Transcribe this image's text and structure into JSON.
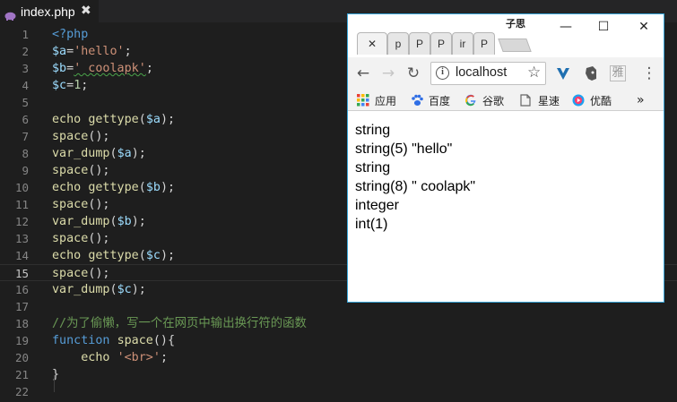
{
  "editor": {
    "tab": {
      "filename": "index.php",
      "close": "✖"
    },
    "lines": [
      {
        "n": "1",
        "tokens": [
          {
            "t": "<?php",
            "c": "kw"
          }
        ]
      },
      {
        "n": "2",
        "tokens": [
          {
            "t": "$a",
            "c": "var"
          },
          {
            "t": "=",
            "c": ""
          },
          {
            "t": "'hello'",
            "c": "str"
          },
          {
            "t": ";",
            "c": ""
          }
        ]
      },
      {
        "n": "3",
        "tokens": [
          {
            "t": "$b",
            "c": "var"
          },
          {
            "t": "=",
            "c": ""
          },
          {
            "t": "' coolapk'",
            "c": "str squig"
          },
          {
            "t": ";",
            "c": ""
          }
        ]
      },
      {
        "n": "4",
        "tokens": [
          {
            "t": "$c",
            "c": "var"
          },
          {
            "t": "=",
            "c": ""
          },
          {
            "t": "1",
            "c": "num"
          },
          {
            "t": ";",
            "c": ""
          }
        ]
      },
      {
        "n": "5",
        "tokens": []
      },
      {
        "n": "6",
        "tokens": [
          {
            "t": "echo ",
            "c": "fn"
          },
          {
            "t": "gettype",
            "c": "fn"
          },
          {
            "t": "(",
            "c": ""
          },
          {
            "t": "$a",
            "c": "var"
          },
          {
            "t": ");",
            "c": ""
          }
        ]
      },
      {
        "n": "7",
        "tokens": [
          {
            "t": "space",
            "c": "fn"
          },
          {
            "t": "();",
            "c": ""
          }
        ]
      },
      {
        "n": "8",
        "tokens": [
          {
            "t": "var_dump",
            "c": "fn"
          },
          {
            "t": "(",
            "c": ""
          },
          {
            "t": "$a",
            "c": "var"
          },
          {
            "t": ");",
            "c": ""
          }
        ]
      },
      {
        "n": "9",
        "tokens": [
          {
            "t": "space",
            "c": "fn"
          },
          {
            "t": "();",
            "c": ""
          }
        ]
      },
      {
        "n": "10",
        "tokens": [
          {
            "t": "echo ",
            "c": "fn"
          },
          {
            "t": "gettype",
            "c": "fn"
          },
          {
            "t": "(",
            "c": ""
          },
          {
            "t": "$b",
            "c": "var"
          },
          {
            "t": ");",
            "c": ""
          }
        ]
      },
      {
        "n": "11",
        "tokens": [
          {
            "t": "space",
            "c": "fn"
          },
          {
            "t": "();",
            "c": ""
          }
        ]
      },
      {
        "n": "12",
        "tokens": [
          {
            "t": "var_dump",
            "c": "fn"
          },
          {
            "t": "(",
            "c": ""
          },
          {
            "t": "$b",
            "c": "var"
          },
          {
            "t": ");",
            "c": ""
          }
        ]
      },
      {
        "n": "13",
        "tokens": [
          {
            "t": "space",
            "c": "fn"
          },
          {
            "t": "();",
            "c": ""
          }
        ]
      },
      {
        "n": "14",
        "tokens": [
          {
            "t": "echo ",
            "c": "fn"
          },
          {
            "t": "gettype",
            "c": "fn"
          },
          {
            "t": "(",
            "c": ""
          },
          {
            "t": "$c",
            "c": "var"
          },
          {
            "t": ");",
            "c": ""
          }
        ]
      },
      {
        "n": "15",
        "tokens": [
          {
            "t": "space",
            "c": "fn"
          },
          {
            "t": "();",
            "c": ""
          }
        ],
        "current": true
      },
      {
        "n": "16",
        "tokens": [
          {
            "t": "var_dump",
            "c": "fn"
          },
          {
            "t": "(",
            "c": ""
          },
          {
            "t": "$c",
            "c": "var"
          },
          {
            "t": ");",
            "c": ""
          }
        ]
      },
      {
        "n": "17",
        "tokens": []
      },
      {
        "n": "18",
        "tokens": [
          {
            "t": "//为了偷懒，写一个在网页中输出换行符的函数",
            "c": "cmt"
          }
        ]
      },
      {
        "n": "19",
        "tokens": [
          {
            "t": "function ",
            "c": "kw"
          },
          {
            "t": "space",
            "c": "fn"
          },
          {
            "t": "(){",
            "c": ""
          }
        ]
      },
      {
        "n": "20",
        "tokens": [
          {
            "t": "    echo ",
            "c": "fn"
          },
          {
            "t": "'<br>'",
            "c": "str"
          },
          {
            "t": ";",
            "c": ""
          }
        ]
      },
      {
        "n": "21",
        "tokens": [
          {
            "t": "}",
            "c": ""
          }
        ]
      },
      {
        "n": "22",
        "tokens": []
      }
    ]
  },
  "browser": {
    "profile_name": "子思",
    "tabs": [
      {
        "label": "✕",
        "active": true
      },
      {
        "label": "p"
      },
      {
        "label": "P"
      },
      {
        "label": "P"
      },
      {
        "label": "ir"
      },
      {
        "label": "P"
      }
    ],
    "window_buttons": {
      "minimize": "—",
      "maximize": "☐",
      "close": "✕"
    },
    "toolbar": {
      "back": "←",
      "forward": "→",
      "reload": "↻",
      "url": "localhost",
      "info": "i",
      "star": "☆",
      "menu": "⋮",
      "extensions": [
        "vivaldi-v-icon",
        "evernote-icon",
        "ya-extension-icon"
      ],
      "ext_label_ya": "雅"
    },
    "bookmarks": [
      {
        "label": "应用",
        "icon": "apps-grid-icon"
      },
      {
        "label": "百度",
        "icon": "baidu-paw-icon"
      },
      {
        "label": "谷歌",
        "icon": "google-g-icon"
      },
      {
        "label": "星速",
        "icon": "page-icon"
      },
      {
        "label": "优酷",
        "icon": "youku-icon"
      }
    ],
    "more": "»",
    "output": [
      "string",
      "string(5) \"hello\"",
      "string",
      "string(8) \" coolapk\"",
      "integer",
      "int(1)"
    ]
  }
}
